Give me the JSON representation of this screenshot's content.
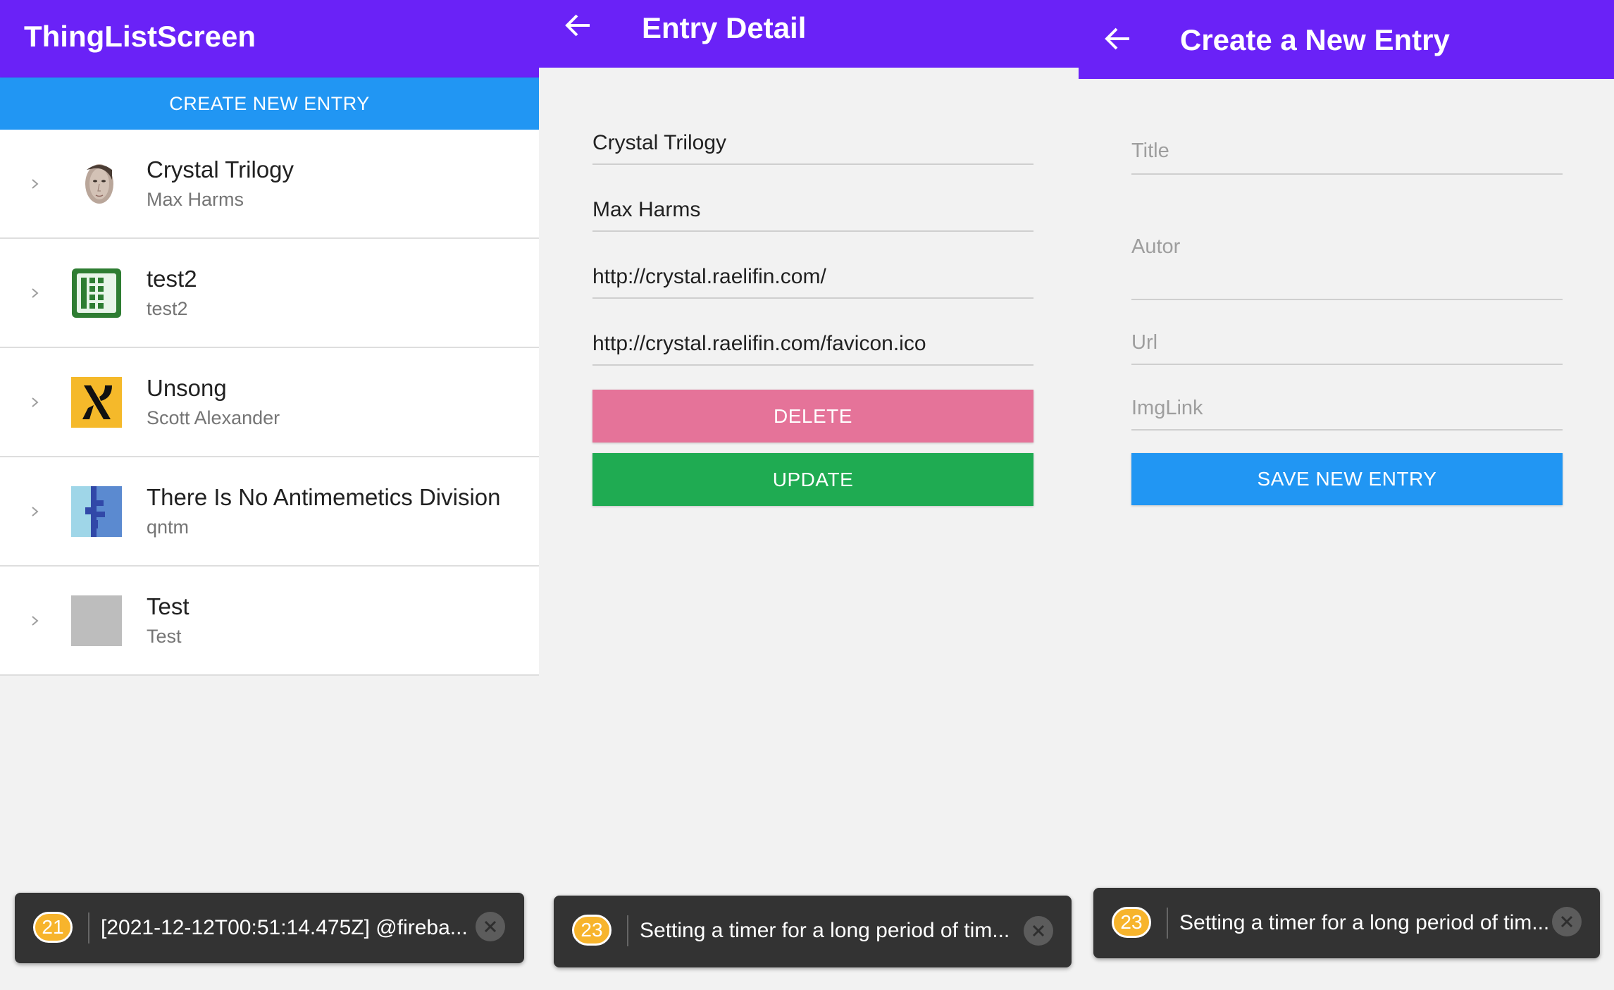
{
  "list_screen": {
    "title": "ThingListScreen",
    "create_button": "CREATE NEW ENTRY",
    "items": [
      {
        "title": "Crystal Trilogy",
        "subtitle": "Max Harms"
      },
      {
        "title": "test2",
        "subtitle": "test2"
      },
      {
        "title": "Unsong",
        "subtitle": "Scott Alexander"
      },
      {
        "title": "There Is No Antimemetics Division",
        "subtitle": "qntm"
      },
      {
        "title": "Test",
        "subtitle": "Test"
      }
    ],
    "toast": {
      "count": "21",
      "message": "[2021-12-12T00:51:14.475Z]  @fireba..."
    }
  },
  "detail_screen": {
    "title": "Entry Detail",
    "fields": {
      "title": "Crystal Trilogy",
      "author": "Max Harms",
      "url": "http://crystal.raelifin.com/",
      "img": "http://crystal.raelifin.com/favicon.ico"
    },
    "delete_button": "DELETE",
    "update_button": "UPDATE",
    "toast": {
      "count": "23",
      "message": "Setting a timer for a long period of tim..."
    }
  },
  "create_screen": {
    "title": "Create a New Entry",
    "placeholders": {
      "title": "Title",
      "author": "Autor",
      "url": "Url",
      "img": "ImgLink"
    },
    "save_button": "SAVE NEW ENTRY",
    "toast": {
      "count": "23",
      "message": "Setting a timer for a long period of tim..."
    }
  },
  "colors": {
    "app_bar": "#6a22f7",
    "primary_button": "#2196f3",
    "delete_button": "#e57399",
    "update_button": "#1fab52",
    "toast_badge": "#f7b42c"
  }
}
